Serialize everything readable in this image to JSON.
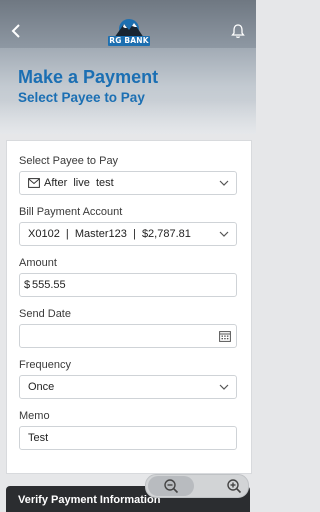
{
  "header": {
    "logo_text": "RG BANK",
    "back_icon": "chevron-left-icon",
    "notification_icon": "bell-icon"
  },
  "banner": {
    "title": "Make a Payment",
    "subtitle": "Select Payee to Pay"
  },
  "form": {
    "payee": {
      "label": "Select Payee to Pay",
      "value": "After  live  test",
      "icon": "mail-icon"
    },
    "account": {
      "label": "Bill Payment Account",
      "value": "X0102  |  Master123  |  $2,787.81"
    },
    "amount": {
      "label": "Amount",
      "currency": "$",
      "value": "555.55"
    },
    "send_date": {
      "label": "Send Date",
      "value": "",
      "icon": "calendar-icon"
    },
    "frequency": {
      "label": "Frequency",
      "value": "Once"
    },
    "memo": {
      "label": "Memo",
      "value": "Test"
    }
  },
  "zoom": {
    "out_icon": "zoom-out-icon",
    "in_icon": "zoom-in-icon"
  },
  "footer": {
    "label": "Verify Payment Information"
  },
  "colors": {
    "brand_blue": "#1b6fb3",
    "footer_bg": "#2b2d30"
  }
}
